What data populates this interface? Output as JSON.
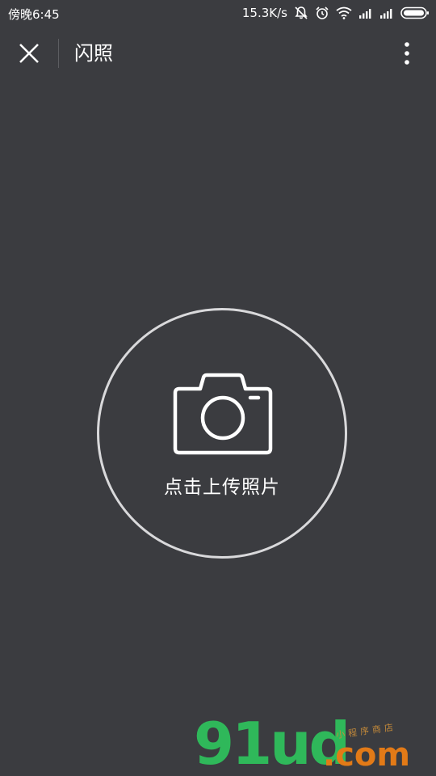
{
  "status_bar": {
    "time": "傍晚6:45",
    "network_speed": "15.3K/s",
    "icons": [
      "mute-notification-icon",
      "alarm-icon",
      "wifi-icon",
      "signal-icon-1",
      "signal-icon-2",
      "battery-icon"
    ]
  },
  "title_bar": {
    "title": "闪照",
    "close_icon": "close-icon",
    "more_icon": "more-vertical-icon"
  },
  "upload": {
    "label": "点击上传照片",
    "icon": "camera-icon"
  },
  "watermark": {
    "logo": "91ud",
    "suffix": ".com",
    "small_text": "小程序商店"
  },
  "colors": {
    "background": "#3b3c40",
    "circle_border": "#d9d9db",
    "text": "#ffffff",
    "watermark_green": "#2fb85a",
    "watermark_orange": "#e27a17"
  }
}
